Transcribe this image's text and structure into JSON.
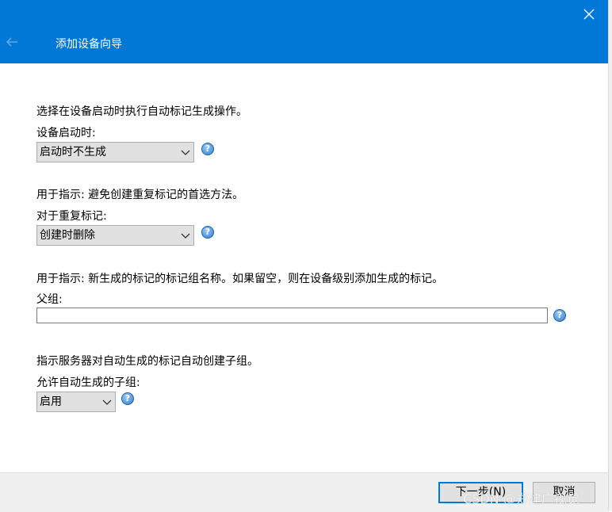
{
  "header": {
    "title": "添加设备向导",
    "back_icon": "back-arrow-icon",
    "close_glyph": "✕"
  },
  "section1": {
    "description": "选择在设备启动时执行自动标记生成操作。",
    "label": "设备启动时:",
    "selected": "启动时不生成"
  },
  "section2": {
    "description": "用于指示: 避免创建重复标记的首选方法。",
    "label": "对于重复标记:",
    "selected": "创建时删除"
  },
  "section3": {
    "description": "用于指示: 新生成的标记的标记组名称。如果留空，则在设备级别添加生成的标记。",
    "label": "父组:",
    "value": ""
  },
  "section4": {
    "description": "指示服务器对自动生成的标记自动创建子组。",
    "label": "允许自动生成的子组:",
    "selected": "启用"
  },
  "footer": {
    "next_label": "下一步(N)",
    "cancel_label": "取消"
  },
  "help_glyph": "?",
  "watermark": "CSDN @郑建广视觉",
  "colors": {
    "accent": "#0078d7",
    "control_bg": "#e1e1e1",
    "footer_bg": "#f0f0f0"
  }
}
